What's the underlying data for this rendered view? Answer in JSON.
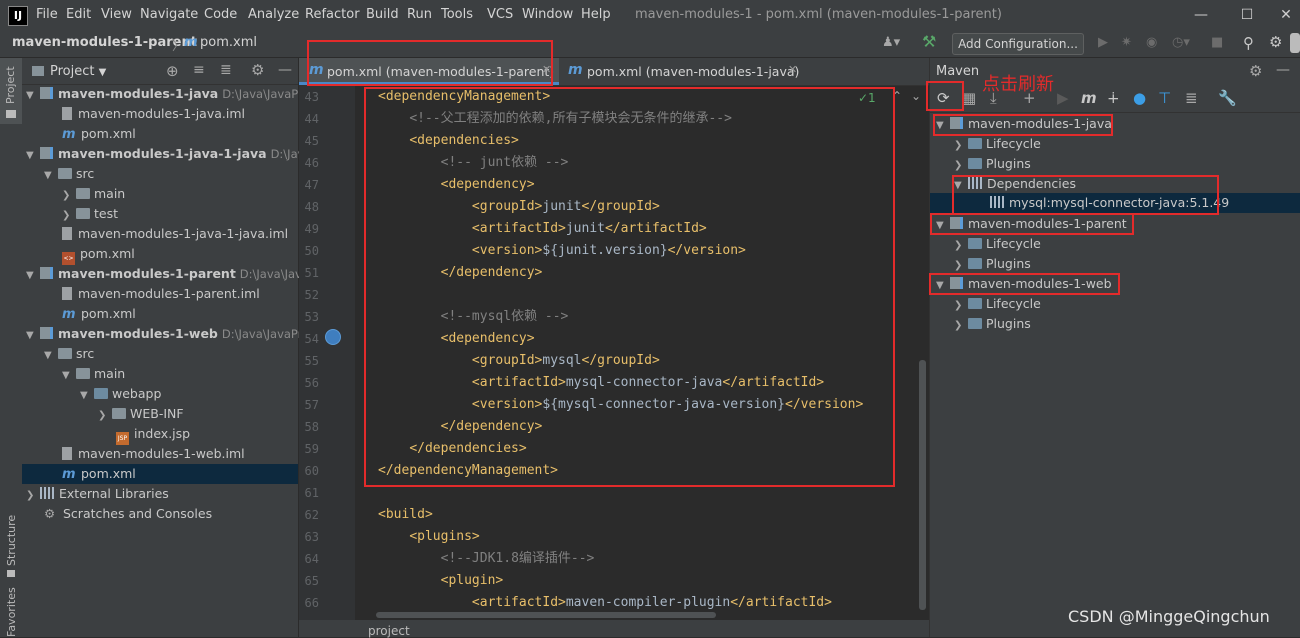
{
  "titlebar": {
    "logo": "IJ",
    "menu": [
      "File",
      "Edit",
      "View",
      "Navigate",
      "Code",
      "Analyze",
      "Refactor",
      "Build",
      "Run",
      "Tools",
      "VCS",
      "Window",
      "Help"
    ],
    "title": "maven-modules-1 - pom.xml (maven-modules-1-parent)"
  },
  "navbar": {
    "project": "maven-modules-1-parent",
    "separator": "〉",
    "file_icon": "m",
    "file": "pom.xml",
    "add_configuration": "Add Configuration..."
  },
  "left_stripe": {
    "project": "Project",
    "structure": "Structure",
    "favorites": "Favorites"
  },
  "project_panel": {
    "title": "Project",
    "items": [
      {
        "label": "maven-modules-1-java",
        "path": "D:\\Java\\JavaPr"
      },
      {
        "label": "maven-modules-1-java.iml"
      },
      {
        "label": "pom.xml"
      },
      {
        "label": "maven-modules-1-java-1-java",
        "path": "D:\\Java\\"
      },
      {
        "label": "src"
      },
      {
        "label": "main"
      },
      {
        "label": "test"
      },
      {
        "label": "maven-modules-1-java-1-java.iml"
      },
      {
        "label": "pom.xml"
      },
      {
        "label": "maven-modules-1-parent",
        "path": "D:\\Java\\Java"
      },
      {
        "label": "maven-modules-1-parent.iml"
      },
      {
        "label": "pom.xml"
      },
      {
        "label": "maven-modules-1-web",
        "path": "D:\\Java\\JavaPr"
      },
      {
        "label": "src"
      },
      {
        "label": "main"
      },
      {
        "label": "webapp"
      },
      {
        "label": "WEB-INF"
      },
      {
        "label": "index.jsp"
      },
      {
        "label": "maven-modules-1-web.iml"
      },
      {
        "label": "pom.xml"
      },
      {
        "label": "External Libraries"
      },
      {
        "label": "Scratches and Consoles"
      }
    ]
  },
  "editor": {
    "tabs": [
      {
        "label": "pom.xml (maven-modules-1-parent)"
      },
      {
        "label": "pom.xml (maven-modules-1-java)"
      }
    ],
    "inspection": "✓1",
    "bottom_tab": "project",
    "lines": [
      {
        "n": "43",
        "parts": [
          {
            "c": "t",
            "s": "<dependencyManagement>"
          }
        ]
      },
      {
        "n": "44",
        "parts": [
          {
            "c": "x",
            "s": "    "
          },
          {
            "c": "c",
            "s": "<!--父工程添加的依赖,所有子模块会无条件的继承-->"
          }
        ]
      },
      {
        "n": "45",
        "parts": [
          {
            "c": "x",
            "s": "    "
          },
          {
            "c": "t",
            "s": "<dependencies>"
          }
        ]
      },
      {
        "n": "46",
        "parts": [
          {
            "c": "x",
            "s": "        "
          },
          {
            "c": "c",
            "s": "<!-- junt依赖 -->"
          }
        ]
      },
      {
        "n": "47",
        "parts": [
          {
            "c": "x",
            "s": "        "
          },
          {
            "c": "t",
            "s": "<dependency>"
          }
        ]
      },
      {
        "n": "48",
        "parts": [
          {
            "c": "x",
            "s": "            "
          },
          {
            "c": "t",
            "s": "<groupId>"
          },
          {
            "c": "x",
            "s": "junit"
          },
          {
            "c": "t",
            "s": "</groupId>"
          }
        ]
      },
      {
        "n": "49",
        "parts": [
          {
            "c": "x",
            "s": "            "
          },
          {
            "c": "t",
            "s": "<artifactId>"
          },
          {
            "c": "x",
            "s": "junit"
          },
          {
            "c": "t",
            "s": "</artifactId>"
          }
        ]
      },
      {
        "n": "50",
        "parts": [
          {
            "c": "x",
            "s": "            "
          },
          {
            "c": "t",
            "s": "<version>"
          },
          {
            "c": "x",
            "s": "${junit.version}"
          },
          {
            "c": "t",
            "s": "</version>"
          }
        ]
      },
      {
        "n": "51",
        "parts": [
          {
            "c": "x",
            "s": "        "
          },
          {
            "c": "t",
            "s": "</dependency>"
          }
        ]
      },
      {
        "n": "52",
        "parts": []
      },
      {
        "n": "53",
        "parts": [
          {
            "c": "x",
            "s": "        "
          },
          {
            "c": "c",
            "s": "<!--mysql依赖 -->"
          }
        ]
      },
      {
        "n": "54",
        "parts": [
          {
            "c": "x",
            "s": "        "
          },
          {
            "c": "t",
            "s": "<dependency>"
          }
        ]
      },
      {
        "n": "55",
        "parts": [
          {
            "c": "x",
            "s": "            "
          },
          {
            "c": "t",
            "s": "<groupId>"
          },
          {
            "c": "x",
            "s": "mysql"
          },
          {
            "c": "t",
            "s": "</groupId>"
          }
        ]
      },
      {
        "n": "56",
        "parts": [
          {
            "c": "x",
            "s": "            "
          },
          {
            "c": "t",
            "s": "<artifactId>"
          },
          {
            "c": "x",
            "s": "mysql-connector-java"
          },
          {
            "c": "t",
            "s": "</artifactId>"
          }
        ]
      },
      {
        "n": "57",
        "parts": [
          {
            "c": "x",
            "s": "            "
          },
          {
            "c": "t",
            "s": "<version>"
          },
          {
            "c": "x",
            "s": "${mysql-connector-java-version}"
          },
          {
            "c": "t",
            "s": "</version>"
          }
        ]
      },
      {
        "n": "58",
        "parts": [
          {
            "c": "x",
            "s": "        "
          },
          {
            "c": "t",
            "s": "</dependency>"
          }
        ]
      },
      {
        "n": "59",
        "parts": [
          {
            "c": "x",
            "s": "    "
          },
          {
            "c": "t",
            "s": "</dependencies>"
          }
        ]
      },
      {
        "n": "60",
        "parts": [
          {
            "c": "t",
            "s": "</dependencyManagement>"
          }
        ]
      },
      {
        "n": "61",
        "parts": []
      },
      {
        "n": "62",
        "parts": [
          {
            "c": "t",
            "s": "<build>"
          }
        ]
      },
      {
        "n": "63",
        "parts": [
          {
            "c": "x",
            "s": "    "
          },
          {
            "c": "t",
            "s": "<plugins>"
          }
        ]
      },
      {
        "n": "64",
        "parts": [
          {
            "c": "x",
            "s": "        "
          },
          {
            "c": "c",
            "s": "<!--JDK1.8编译插件-->"
          }
        ]
      },
      {
        "n": "65",
        "parts": [
          {
            "c": "x",
            "s": "        "
          },
          {
            "c": "t",
            "s": "<plugin>"
          }
        ]
      },
      {
        "n": "66",
        "parts": [
          {
            "c": "x",
            "s": "            "
          },
          {
            "c": "t",
            "s": "<artifactId>"
          },
          {
            "c": "x",
            "s": "maven-compiler-plugin"
          },
          {
            "c": "t",
            "s": "</artifactId>"
          }
        ]
      }
    ]
  },
  "maven": {
    "title": "Maven",
    "note": "点击刷新",
    "tree": [
      "maven-modules-1-java",
      "Lifecycle",
      "Plugins",
      "Dependencies",
      "mysql:mysql-connector-java:5.1.49",
      "maven-modules-1-parent",
      "Lifecycle",
      "Plugins",
      "maven-modules-1-web",
      "Lifecycle",
      "Plugins"
    ]
  },
  "watermark": "CSDN @MinggeQingchun",
  "colors": {
    "highlight_box": "#e32b2b",
    "tag": "#e8bf6a",
    "comment": "#808080",
    "selection": "#0d293e"
  }
}
